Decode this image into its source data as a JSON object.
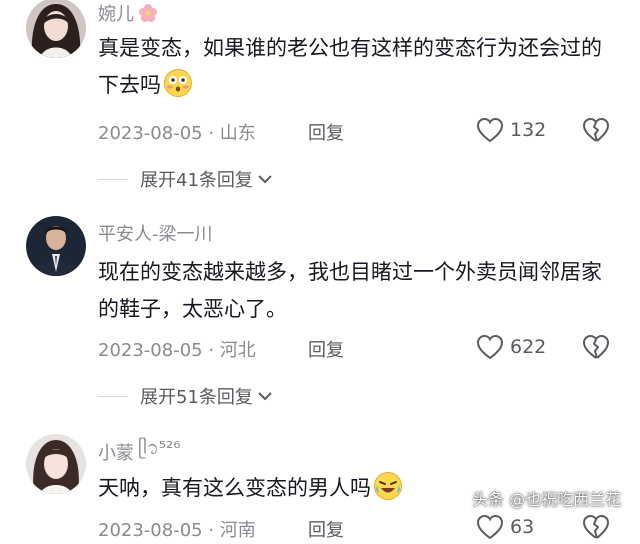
{
  "comments": [
    {
      "username": "婉儿",
      "text": "真是变态，如果谁的老公也有这样的变态行为还会过的下去吗",
      "emoji": "flushed-emoji",
      "date": "2023-08-05",
      "location": "山东",
      "reply_label": "回复",
      "likes": "132",
      "expand_label": "展开41条回复"
    },
    {
      "username": "平安人-梁一川",
      "text": "现在的变态越来越多，我也目睹过一个外卖员闻邻居家的鞋子，太恶心了。",
      "date": "2023-08-05",
      "location": "河北",
      "reply_label": "回复",
      "likes": "622",
      "expand_label": "展开51条回复"
    },
    {
      "username": "小蒙",
      "username_suffix": "ᥫ᭡⁵²⁶",
      "text": "天呐，真有这么变态的男人吗",
      "emoji": "rofl-emoji",
      "date": "2023-08-05",
      "location": "河南",
      "reply_label": "回复",
      "likes": "63"
    }
  ],
  "separator": " · ",
  "watermark": "头条 @也祝吃西兰花",
  "colors": {
    "text": "#161823",
    "secondary": "#8a8b91",
    "action": "#5a5b62"
  }
}
